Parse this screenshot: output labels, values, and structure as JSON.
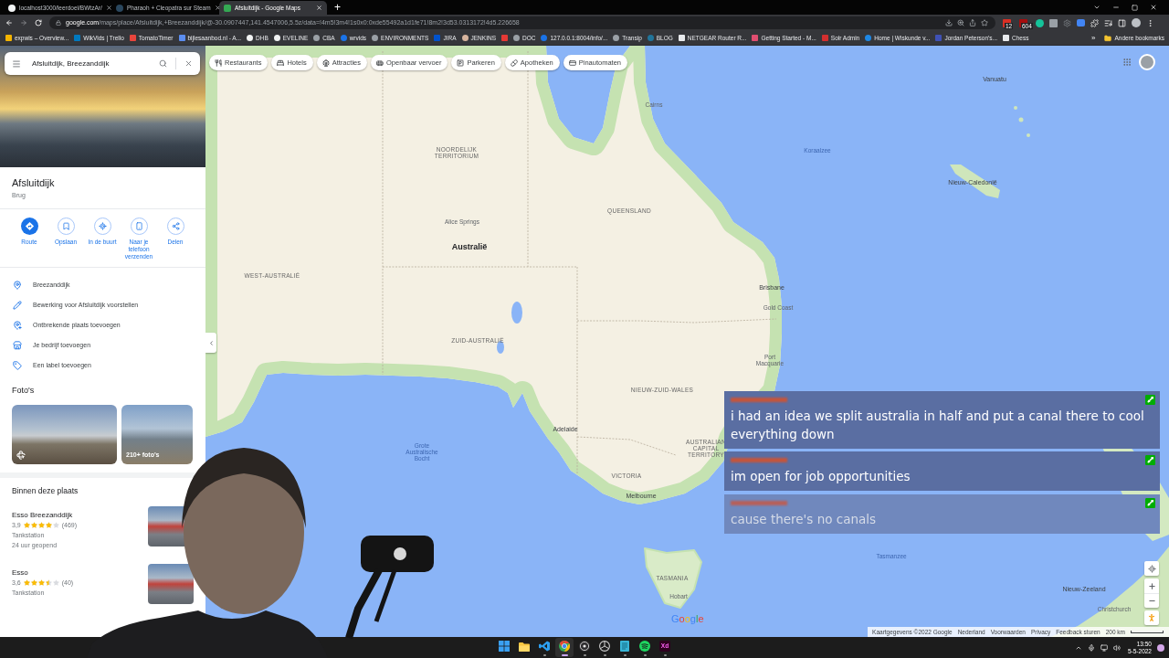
{
  "browser": {
    "tabs": [
      {
        "title": "localhost3000/leerdoel/BWtzAr/",
        "selected": false
      },
      {
        "title": "Pharaoh + Cleopatra sur Steam",
        "selected": false
      },
      {
        "title": "Afsluitdijk - Google Maps",
        "selected": true
      }
    ],
    "new_tab": "+",
    "url": {
      "domain": "google.com",
      "path": "/maps/place/Afsluitdijk,+Breezanddijk/@-30.0907447,141.4547006,5.5z/data=!4m5!3m4!1s0x0:0xde55492a1d1fe71!8m2!3d53.0313172!4d5.226658"
    },
    "extension_badges": [
      "12",
      "604"
    ],
    "bookmarks": [
      {
        "kind": "link",
        "label": "expwis – Overview..."
      },
      {
        "kind": "link",
        "label": "WikVids | Trello"
      },
      {
        "kind": "link",
        "label": "TomatoTimer"
      },
      {
        "kind": "link",
        "label": "bijlesaanbod.nl - A..."
      },
      {
        "kind": "link",
        "label": "DHB"
      },
      {
        "kind": "link",
        "label": "EVELINE"
      },
      {
        "kind": "link",
        "label": "CBA"
      },
      {
        "kind": "link",
        "label": "wrvids"
      },
      {
        "kind": "link",
        "label": "ENVIRONMENTS"
      },
      {
        "kind": "link",
        "label": "JIRA"
      },
      {
        "kind": "link",
        "label": "JENKINS"
      },
      {
        "kind": "icon_only"
      },
      {
        "kind": "link",
        "label": "DOC"
      },
      {
        "kind": "link",
        "label": "127.0.0.1:8004/info/..."
      },
      {
        "kind": "link",
        "label": "Transip"
      },
      {
        "kind": "link",
        "label": "BLOG"
      },
      {
        "kind": "link",
        "label": "NETGEAR Router R..."
      },
      {
        "kind": "link",
        "label": "Getting Started - M..."
      },
      {
        "kind": "link",
        "label": "Solr Admin"
      },
      {
        "kind": "link",
        "label": "Home | Wiskunde v..."
      },
      {
        "kind": "link",
        "label": "Jordan Peterson's..."
      },
      {
        "kind": "link",
        "label": "Chess"
      }
    ],
    "more_bookmarks": "»",
    "other_bookmarks": "Andere bookmarks"
  },
  "place": {
    "search": {
      "value": "Afsluitdijk, Breezanddijk"
    },
    "title": "Afsluitdijk",
    "category": "Brug",
    "actions": [
      {
        "kind": "route",
        "label": "Route"
      },
      {
        "kind": "save",
        "label": "Opslaan"
      },
      {
        "kind": "nearby",
        "label": "In de buurt"
      },
      {
        "kind": "send_to_phone",
        "label": "Naar je telefoon verzenden"
      },
      {
        "kind": "share",
        "label": "Delen"
      }
    ],
    "details": [
      {
        "kind": "address",
        "label": "Breezanddijk"
      },
      {
        "kind": "edit",
        "label": "Bewerking voor Afsluitdijk voorstellen"
      },
      {
        "kind": "add_place",
        "label": "Ontbrekende plaats toevoegen"
      },
      {
        "kind": "business",
        "label": "Je bedrijf toevoegen"
      },
      {
        "kind": "label",
        "label": "Een label toevoegen"
      }
    ],
    "photos": {
      "heading": "Foto's",
      "tiles": [
        {
          "kind": "panorama"
        },
        {
          "kind": "more",
          "label": "210+ foto's"
        }
      ]
    },
    "nearby": {
      "heading": "Binnen deze plaats",
      "places": [
        {
          "name": "Esso Breezanddijk",
          "rating": "3,9",
          "stars": 4,
          "reviews": "(469)",
          "type": "Tankstation",
          "hours": "24 uur geopend"
        },
        {
          "name": "Esso",
          "rating": "3,6",
          "stars": 3.5,
          "reviews": "(40)",
          "type": "Tankstation"
        }
      ]
    }
  },
  "map": {
    "chips": [
      {
        "kind": "restaurants",
        "label": "Restaurants"
      },
      {
        "kind": "hotels",
        "label": "Hotels"
      },
      {
        "kind": "attractions",
        "label": "Attracties"
      },
      {
        "kind": "transit",
        "label": "Openbaar vervoer"
      },
      {
        "kind": "parking",
        "label": "Parkeren"
      },
      {
        "kind": "pharmacy",
        "label": "Apotheken"
      },
      {
        "kind": "atm",
        "label": "Pinautomaten"
      }
    ],
    "labels": [
      {
        "kind": "state",
        "text": "NOORDELIJK TERRITORIUM"
      },
      {
        "kind": "town",
        "text": "Alice Springs"
      },
      {
        "kind": "country",
        "text": "Australië"
      },
      {
        "kind": "state",
        "text": "WEST-AUSTRALIË"
      },
      {
        "kind": "state",
        "text": "QUEENSLAND"
      },
      {
        "kind": "state",
        "text": "ZUID-AUSTRALIË"
      },
      {
        "kind": "state",
        "text": "NIEUW-ZUID-WALES"
      },
      {
        "kind": "city",
        "text": "Brisbane"
      },
      {
        "kind": "city",
        "text": "Adelaide"
      },
      {
        "kind": "state",
        "text": "AUSTRALIAN CAPITAL TERRITORY"
      },
      {
        "kind": "state",
        "text": "VICTORIA"
      },
      {
        "kind": "city",
        "text": "Melbourne"
      },
      {
        "kind": "water",
        "text": "Grote Australische Bocht"
      },
      {
        "kind": "state",
        "text": "TASMANIA"
      },
      {
        "kind": "town",
        "text": "Hobart"
      },
      {
        "kind": "water",
        "text": "Tasmanzee"
      },
      {
        "kind": "water",
        "text": "Koraalzee"
      },
      {
        "kind": "region",
        "text": "Nieuw-Caledonië"
      },
      {
        "kind": "region",
        "text": "Vanuatu"
      },
      {
        "kind": "region",
        "text": "Nieuw-Zeeland"
      },
      {
        "kind": "town",
        "text": "Christchurch"
      },
      {
        "kind": "town",
        "text": "Cairns"
      },
      {
        "kind": "town",
        "text": "Gold Coast"
      },
      {
        "kind": "town",
        "text": "Port Macquarie"
      }
    ],
    "logo": "Google",
    "attribution": [
      "Kaartgegevens ©2022 Google",
      "Nederland",
      "Voorwaarden",
      "Privacy",
      "Feedback sturen"
    ],
    "scale": "200 km"
  },
  "chat": {
    "messages": [
      {
        "text": "i had an idea we split australia in half and put a canal there to cool everything down",
        "faded": false
      },
      {
        "text": "im open for job opportunities",
        "faded": false
      },
      {
        "text": "cause there's no canals",
        "faded": true
      }
    ]
  },
  "taskbar": {
    "apps": [
      {
        "kind": "start",
        "selected": false,
        "running": false
      },
      {
        "kind": "explorer",
        "selected": false,
        "running": false
      },
      {
        "kind": "code",
        "selected": false,
        "running": true
      },
      {
        "kind": "browser",
        "selected": true,
        "running": true
      },
      {
        "kind": "recorder",
        "selected": false,
        "running": true
      },
      {
        "kind": "aperture",
        "selected": false,
        "running": true
      },
      {
        "kind": "notes",
        "selected": false,
        "running": true
      },
      {
        "kind": "music",
        "selected": false,
        "running": true
      },
      {
        "kind": "design",
        "label": "Xd",
        "selected": false,
        "running": true
      }
    ],
    "clock": {
      "time": "13:50",
      "date": "5-5-2022"
    }
  }
}
